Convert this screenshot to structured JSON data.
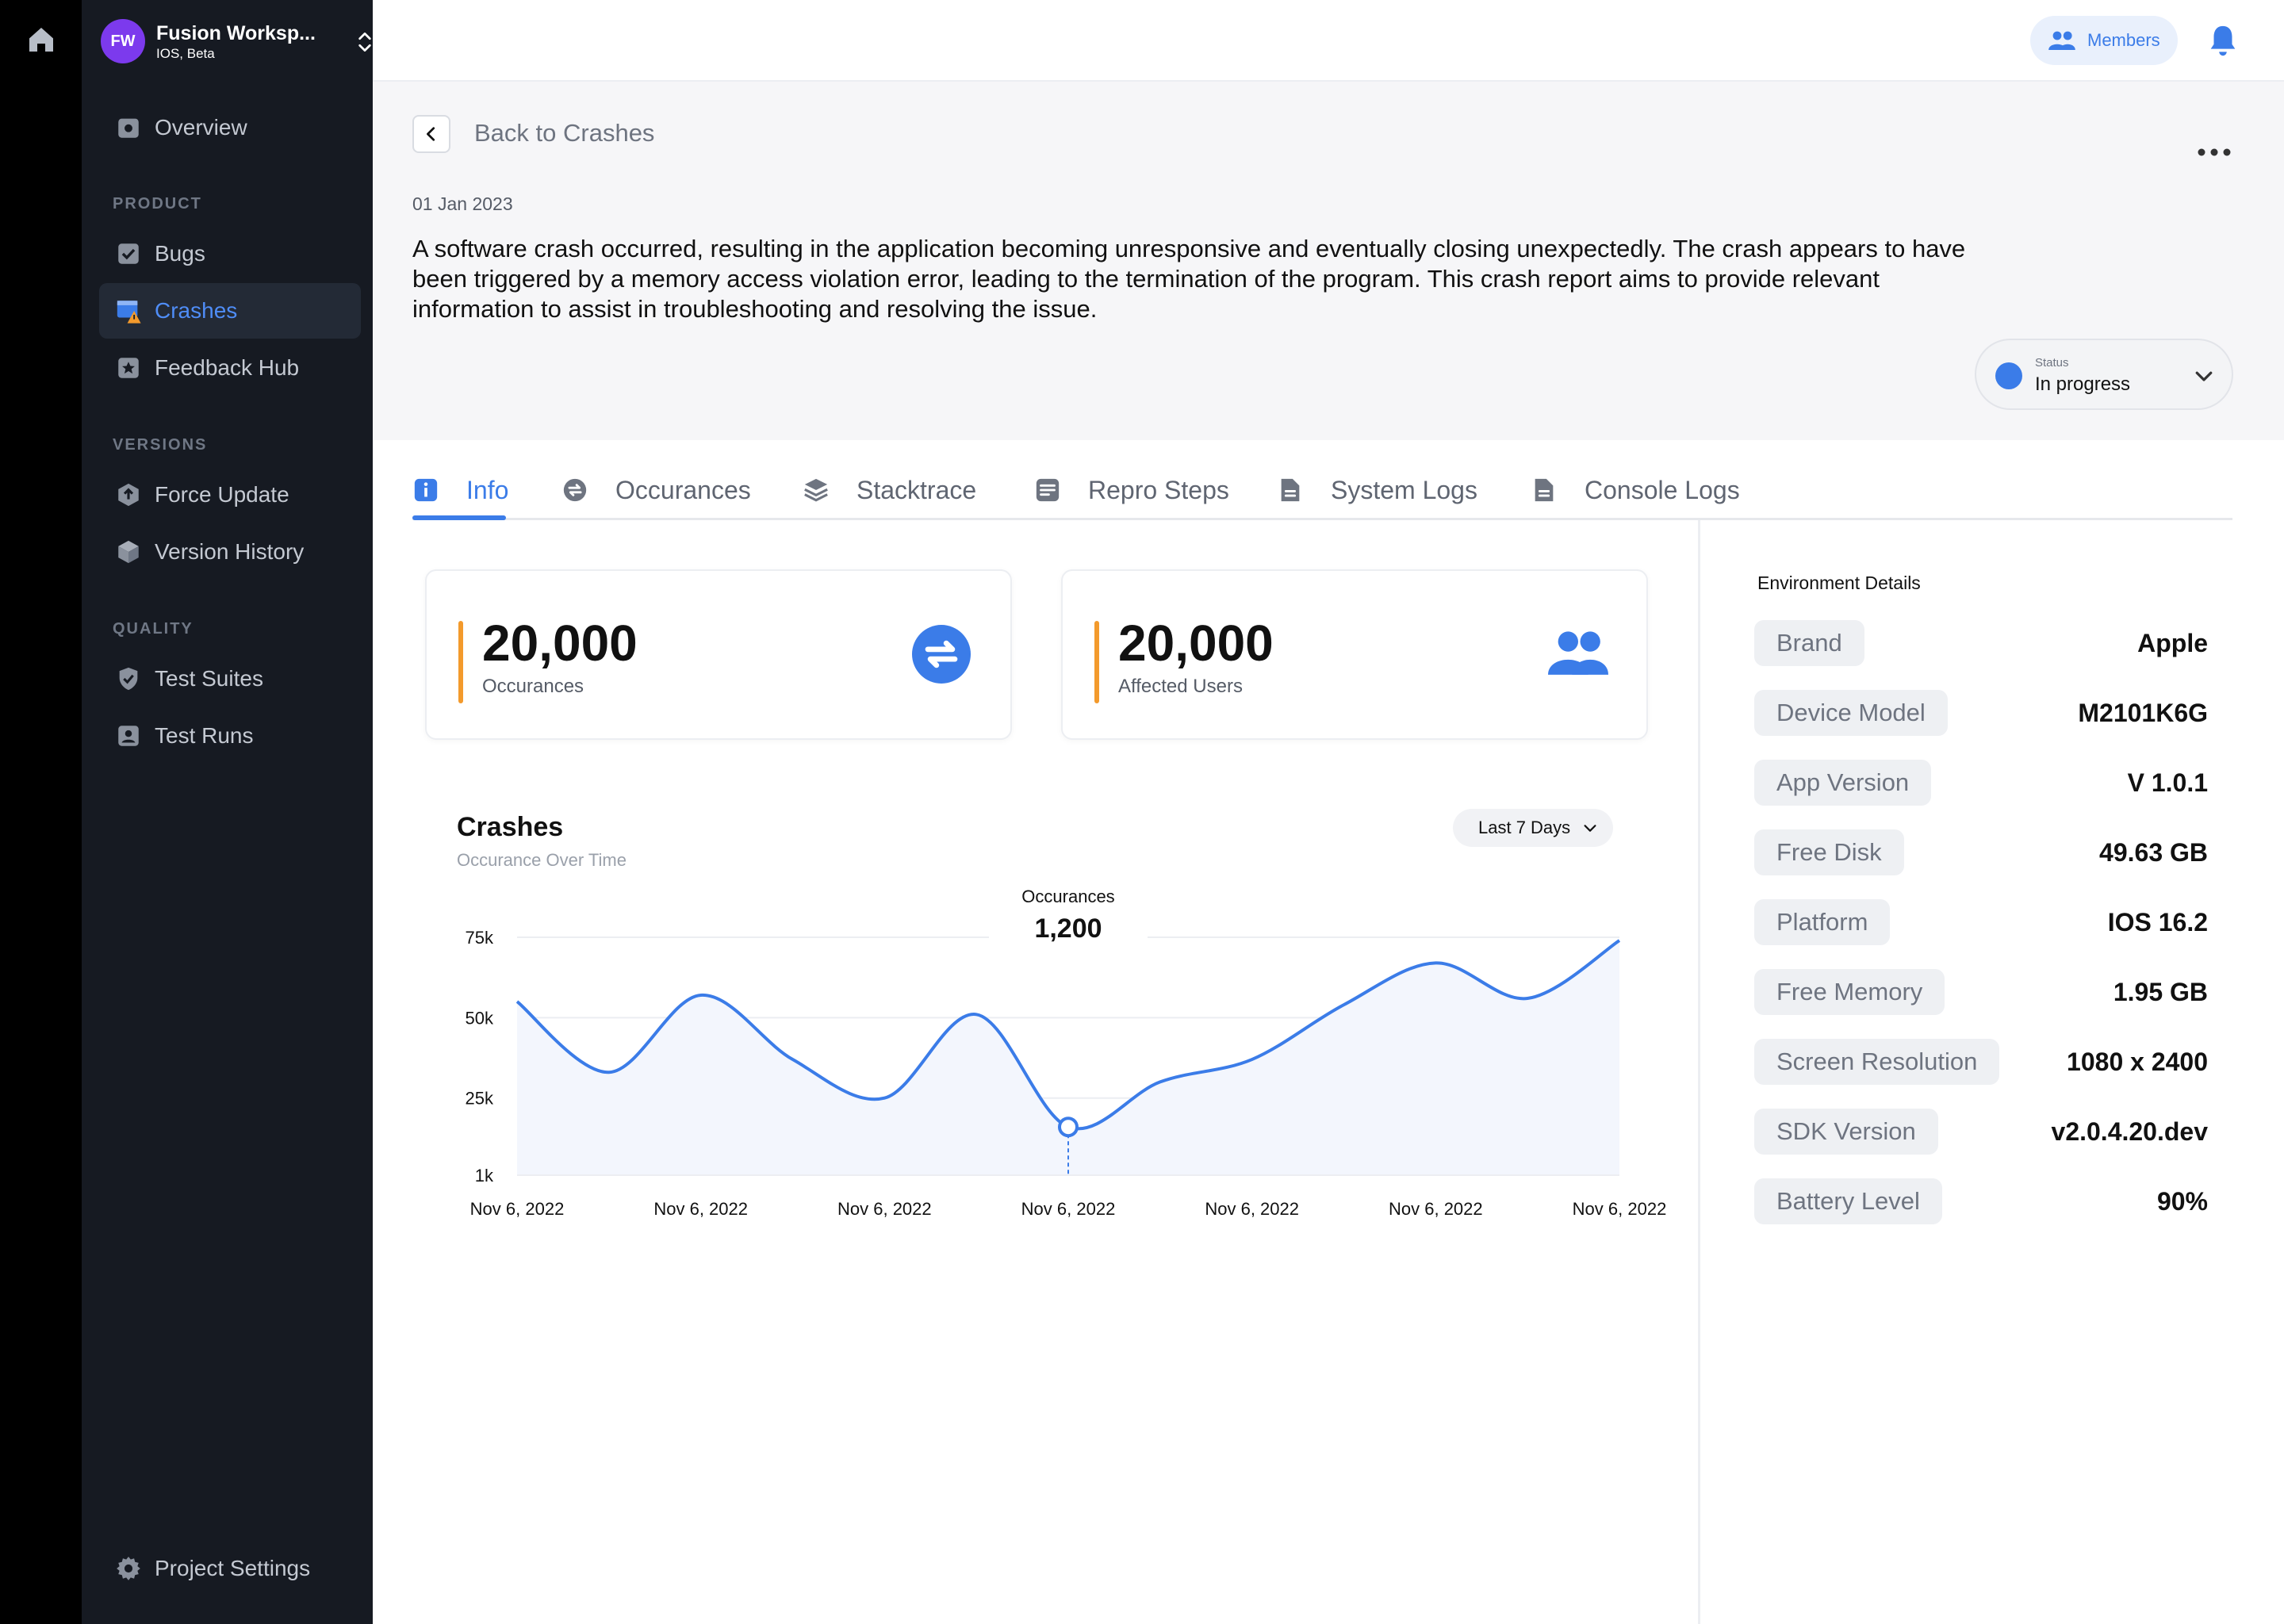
{
  "workspace": {
    "initials": "FW",
    "name": "Fusion Worksp...",
    "sub": "IOS, Beta"
  },
  "nav": {
    "overview": "Overview",
    "product_section": "PRODUCT",
    "bugs": "Bugs",
    "crashes": "Crashes",
    "feedback": "Feedback Hub",
    "versions_section": "VERSIONS",
    "force_update": "Force Update",
    "version_history": "Version History",
    "quality_section": "QUALITY",
    "test_suites": "Test Suites",
    "test_runs": "Test Runs",
    "project_settings": "Project Settings"
  },
  "topbar": {
    "members": "Members"
  },
  "header": {
    "back": "Back to Crashes",
    "date": "01 Jan 2023",
    "description": "A software crash occurred, resulting in the application becoming unresponsive and eventually closing unexpectedly. The crash appears to have been triggered by a memory access violation error, leading to the termination of the program. This crash report aims to provide relevant information to assist in troubleshooting and resolving the issue.",
    "status_label": "Status",
    "status_value": "In progress"
  },
  "tabs": [
    "Info",
    "Occurances",
    "Stacktrace",
    "Repro Steps",
    "System Logs",
    "Console Logs"
  ],
  "stats": {
    "occurances_value": "20,000",
    "occurances_label": "Occurances",
    "users_value": "20,000",
    "users_label": "Affected Users"
  },
  "chart_header": {
    "title": "Crashes",
    "subtitle": "Occurance Over Time",
    "range": "Last 7 Days"
  },
  "chart_data": {
    "type": "line",
    "categories": [
      "Nov 6, 2022",
      "Nov 6, 2022",
      "Nov 6, 2022",
      "Nov 6, 2022",
      "Nov 6, 2022",
      "Nov 6, 2022",
      "Nov 6, 2022"
    ],
    "y_ticks": [
      "75k",
      "50k",
      "25k",
      "1k"
    ],
    "ylim": [
      1000,
      75000
    ],
    "x": [
      0,
      0.5,
      1,
      1.5,
      2,
      2.5,
      3,
      3.5,
      4,
      4.5,
      5,
      5.5,
      6
    ],
    "values": [
      55000,
      33000,
      57000,
      37000,
      25000,
      51000,
      16000,
      30000,
      37000,
      54000,
      67000,
      56000,
      74000
    ],
    "tooltip": {
      "label": "Occurances",
      "value": "1,200",
      "x": 3
    },
    "grid": true,
    "legend": "none"
  },
  "environment": {
    "title": "Environment Details",
    "rows": [
      {
        "key": "Brand",
        "value": "Apple"
      },
      {
        "key": "Device Model",
        "value": "M2101K6G"
      },
      {
        "key": "App Version",
        "value": "V 1.0.1"
      },
      {
        "key": "Free Disk",
        "value": "49.63 GB"
      },
      {
        "key": "Platform",
        "value": "IOS 16.2"
      },
      {
        "key": "Free Memory",
        "value": "1.95 GB"
      },
      {
        "key": "Screen Resolution",
        "value": "1080 x 2400"
      },
      {
        "key": "SDK Version",
        "value": "v2.0.4.20.dev"
      },
      {
        "key": "Battery Level",
        "value": "90%"
      }
    ]
  },
  "colors": {
    "accent": "#3b7ce8",
    "orange": "#f39a2c",
    "sidebar": "#161a22",
    "workspace_avatar": "#7c3aed"
  },
  "icons": [
    "home-icon",
    "overview-icon",
    "bug-icon",
    "crash-icon",
    "star-icon",
    "upload-icon",
    "box-icon",
    "shield-icon",
    "test-run-icon",
    "gear-icon",
    "users-icon",
    "bell-icon",
    "info-icon",
    "refresh-icon",
    "layers-icon",
    "list-icon",
    "file-icon"
  ]
}
